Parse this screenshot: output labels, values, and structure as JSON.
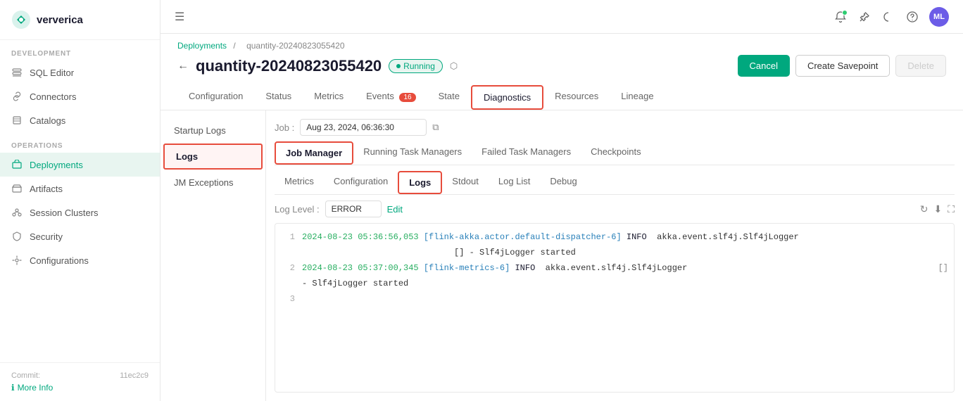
{
  "app": {
    "logo_text": "ververica",
    "avatar_initials": "ML"
  },
  "sidebar": {
    "section_development": "DEVELOPMENT",
    "section_operations": "OPERATIONS",
    "items_development": [
      {
        "id": "sql-editor",
        "label": "SQL Editor",
        "icon": "db"
      },
      {
        "id": "connectors",
        "label": "Connectors",
        "icon": "link"
      },
      {
        "id": "catalogs",
        "label": "Catalogs",
        "icon": "catalog"
      }
    ],
    "items_operations": [
      {
        "id": "deployments",
        "label": "Deployments",
        "icon": "deploy",
        "active": true
      },
      {
        "id": "artifacts",
        "label": "Artifacts",
        "icon": "artifact"
      },
      {
        "id": "session-clusters",
        "label": "Session Clusters",
        "icon": "cluster"
      },
      {
        "id": "security",
        "label": "Security",
        "icon": "security"
      },
      {
        "id": "configurations",
        "label": "Configurations",
        "icon": "config"
      }
    ],
    "commit_label": "Commit:",
    "commit_value": "11ec2c9",
    "more_info": "More Info"
  },
  "breadcrumb": {
    "parent": "Deployments",
    "separator": "/",
    "current": "quantity-20240823055420"
  },
  "deployment": {
    "title": "quantity-20240823055420",
    "status": "Running",
    "actions": {
      "cancel": "Cancel",
      "create_savepoint": "Create Savepoint",
      "delete": "Delete"
    }
  },
  "tabs": [
    {
      "id": "configuration",
      "label": "Configuration"
    },
    {
      "id": "status",
      "label": "Status"
    },
    {
      "id": "metrics",
      "label": "Metrics"
    },
    {
      "id": "events",
      "label": "Events",
      "badge": "16"
    },
    {
      "id": "state",
      "label": "State"
    },
    {
      "id": "diagnostics",
      "label": "Diagnostics",
      "active": true,
      "highlighted": true
    },
    {
      "id": "resources",
      "label": "Resources"
    },
    {
      "id": "lineage",
      "label": "Lineage"
    }
  ],
  "content_sidebar": [
    {
      "id": "startup-logs",
      "label": "Startup Logs"
    },
    {
      "id": "logs",
      "label": "Logs",
      "active": true
    },
    {
      "id": "jm-exceptions",
      "label": "JM Exceptions"
    }
  ],
  "sub_tabs": [
    {
      "id": "job-manager",
      "label": "Job Manager",
      "active": true,
      "highlighted": true
    },
    {
      "id": "running-task-managers",
      "label": "Running Task Managers"
    },
    {
      "id": "failed-task-managers",
      "label": "Failed Task Managers"
    },
    {
      "id": "checkpoints",
      "label": "Checkpoints"
    }
  ],
  "sub_tabs2": [
    {
      "id": "metrics",
      "label": "Metrics"
    },
    {
      "id": "configuration",
      "label": "Configuration"
    },
    {
      "id": "logs",
      "label": "Logs",
      "active": true,
      "highlighted": true
    },
    {
      "id": "stdout",
      "label": "Stdout"
    },
    {
      "id": "log-list",
      "label": "Log List"
    },
    {
      "id": "debug",
      "label": "Debug"
    }
  ],
  "job_selector": {
    "label": "Job :",
    "value": "Aug 23, 2024, 06:36:30"
  },
  "log_level": {
    "label": "Log Level :",
    "value": "ERROR",
    "edit_label": "Edit"
  },
  "log_lines": [
    {
      "num": "1",
      "time": "2024-08-23 05:36:56,053",
      "thread": "[flink-akka.actor.default-dispatcher-6]",
      "level": "INFO",
      "text": "akka.event.slf4j.Slf4jLogger",
      "continuation": "                              [] - Slf4jLogger started",
      "has_expand": false
    },
    {
      "num": "2",
      "time": "2024-08-23 05:37:00,345",
      "thread": "[flink-metrics-6]",
      "level": "INFO",
      "text": "akka.event.slf4j.Slf4jLogger",
      "continuation": "- Slf4jLogger started",
      "has_expand": true
    },
    {
      "num": "3",
      "time": "",
      "thread": "",
      "level": "",
      "text": "",
      "continuation": "",
      "has_expand": false
    }
  ]
}
